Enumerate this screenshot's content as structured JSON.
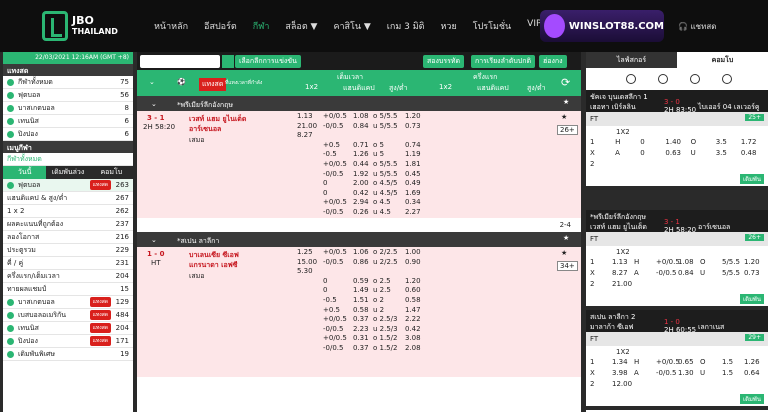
{
  "brand": {
    "line1": "JBO",
    "line2": "THAILAND",
    "partner": "WINSLOT88.COM",
    "chat": "แชทสด"
  },
  "nav": [
    "หน้าหลัก",
    "อีสปอร์ต",
    "กีฬา",
    "สล็อต ▼",
    "คาสิโน ▼",
    "เกม 3 มิติ",
    "หวย",
    "โปรโมชั่น",
    "VIP"
  ],
  "left": {
    "datetime": "22/03/2021 12:16AM (GMT +8)",
    "sec1": "แทงสด",
    "items1": [
      {
        "l": "กีฬาทั้งหมด",
        "c": "75"
      },
      {
        "l": "ฟุตบอล",
        "c": "56"
      },
      {
        "l": "บาสเกตบอล",
        "c": "8"
      },
      {
        "l": "เทนนิส",
        "c": "6"
      },
      {
        "l": "ปิงปอง",
        "c": "6"
      }
    ],
    "sec2": "เมนูกีฬา",
    "all": "กีฬาทั้งหมด",
    "tabs": [
      "วันนี้",
      "เดิมพันล่วงหน้า",
      "คอมโบ"
    ],
    "football": "ฟุตบอล",
    "live": "แทงสด",
    "fcount": "263",
    "items2": [
      {
        "l": "แฮนดิแคป & สูง/ต่ำ",
        "c": "267"
      },
      {
        "l": "1 x 2",
        "c": "262"
      },
      {
        "l": "ผลคะแนนที่ถูกต้อง",
        "c": "237"
      },
      {
        "l": "ลองโอกาส",
        "c": "216"
      },
      {
        "l": "ประตูรวม",
        "c": "229"
      },
      {
        "l": "คี่ / คู่",
        "c": "231"
      },
      {
        "l": "ครึ่งแรก/เต็มเวลา",
        "c": "204"
      },
      {
        "l": "ทายผลแชมป์",
        "c": "15"
      }
    ],
    "items3": [
      {
        "l": "บาสเกตบอล",
        "c": "129"
      },
      {
        "l": "เบสบอลอเมริกัน",
        "c": "484"
      },
      {
        "l": "เทนนิส",
        "c": "204"
      },
      {
        "l": "ปิงปอง",
        "c": "171"
      },
      {
        "l": "เดิมพันพิเศษ",
        "c": "19"
      }
    ]
  },
  "mid": {
    "search_btn": "เลือกลีกการแข่งขัน",
    "sort": "สองบรรทัด",
    "filter": "การเรียงลำดับปกติ",
    "odds": "ฮ่องกง",
    "h_full": "เต็มเวลา",
    "h_half": "ครึ่งแรก",
    "h_live": "แทงสด",
    "h_kick": "ที่แทงเวลาที่กำลัง",
    "h_1x2": "1x2",
    "h_hdp": "แฮนดิแคป",
    "h_ou": "สูง/ต่ำ",
    "league1": "*พรีเมียร์ลีกอังกฤษ",
    "score1": "3 - 1",
    "time1": "2H 58:20",
    "home1": "เวสท์ แฮม ยูไนเต็ด",
    "away1": "อาร์เซนอล",
    "draw": "เสมอ",
    "more1": "26+",
    "odds1": [
      [
        "1.13",
        "+0/0.5",
        "1.08",
        "o 5/5.5",
        "1.20"
      ],
      [
        "21.00",
        "-0/0.5",
        "0.84",
        "u 5/5.5",
        "0.73"
      ],
      [
        "8.27",
        "",
        "",
        "",
        ""
      ],
      [
        "",
        "+0.5",
        "0.71",
        "o 5",
        "0.74"
      ],
      [
        "",
        "-0.5",
        "1.26",
        "u 5",
        "1.19"
      ],
      [
        "",
        "+0/0.5",
        "0.44",
        "o 5/5.5",
        "1.81"
      ],
      [
        "",
        "-0/0.5",
        "1.92",
        "u 5/5.5",
        "0.45"
      ],
      [
        "",
        "0",
        "2.00",
        "o 4.5/5",
        "0.49"
      ],
      [
        "",
        "0",
        "0.42",
        "u 4.5/5",
        "1.69"
      ],
      [
        "",
        "+0/0.5",
        "2.94",
        "o 4.5",
        "0.34"
      ],
      [
        "",
        "-0/0.5",
        "0.26",
        "u 4.5",
        "2.27"
      ]
    ],
    "pager": "2-4",
    "league2": "*สเปน ลาลีกา",
    "score2": "1 - 0",
    "time2": "HT",
    "home2": "บาเลนเซีย ซีเอฟ",
    "away2": "แกรนาดา เอฟซี",
    "more2": "34+",
    "odds2": [
      [
        "1.25",
        "+0/0.5",
        "1.06",
        "o 2/2.5",
        "1.00"
      ],
      [
        "15.00",
        "-0/0.5",
        "0.86",
        "u 2/2.5",
        "0.90"
      ],
      [
        "5.30",
        "",
        "",
        "",
        ""
      ],
      [
        "",
        "0",
        "0.59",
        "o 2.5",
        "1.20"
      ],
      [
        "",
        "0",
        "1.49",
        "u 2.5",
        "0.60"
      ],
      [
        "",
        "-0.5",
        "1.51",
        "o 2",
        "0.58"
      ],
      [
        "",
        "+0.5",
        "0.58",
        "u 2",
        "1.47"
      ],
      [
        "",
        "+0/0.5",
        "0.37",
        "o 2.5/3",
        "2.22"
      ],
      [
        "",
        "-0/0.5",
        "2.23",
        "u 2.5/3",
        "0.42"
      ],
      [
        "",
        "+0/0.5",
        "0.31",
        "o 1.5/2",
        "3.08"
      ],
      [
        "",
        "-0/0.5",
        "0.37",
        "o 1.5/2",
        "2.08"
      ]
    ]
  },
  "right": {
    "tab1": "ไลฟ์สกอร์",
    "tab2": "คอมโบ",
    "c1": {
      "l": "ชัคเจ บุนเดสลีกา 1",
      "h": "เฮอทา เบิร์ลลิน",
      "a": "ไบเออร์ 04 เลเวอร์คูเซน",
      "s": "3 - 0",
      "t": "2H 83:50",
      "more": "25+",
      "rows": [
        [
          "1",
          "H",
          "0",
          "1.40",
          "O",
          "3.5",
          "1.72"
        ],
        [
          "X",
          "A",
          "0",
          "0.63",
          "U",
          "3.5",
          "0.48"
        ],
        [
          "2",
          "",
          "",
          "",
          "",
          "",
          ""
        ]
      ]
    },
    "c2": {
      "l": "*พรีเมียร์ลีกอังกฤษ",
      "h": "เวสท์ แฮม ยูไนเต็ด",
      "a": "อาร์เซนอล",
      "s": "3 - 1",
      "t": "2H 58:20",
      "more": "26+",
      "rows": [
        [
          "1",
          "1.13",
          "H",
          "+0/0.5",
          "1.08",
          "O",
          "5/5.5",
          "1.20"
        ],
        [
          "X",
          "8.27",
          "A",
          "-0/0.5",
          "0.84",
          "U",
          "5/5.5",
          "0.73"
        ],
        [
          "2",
          "21.00",
          "",
          "",
          "",
          "",
          "",
          ""
        ]
      ]
    },
    "c3": {
      "l": "สเปน ลาลีกา 2",
      "h": "มาลาก้า ซีเอฟ",
      "a": "เลกาเนส",
      "s": "1 - 0",
      "t": "2H 60:55",
      "more": "29+",
      "rows": [
        [
          "1",
          "1.34",
          "H",
          "+0/0.5",
          "0.65",
          "O",
          "1.5",
          "1.26"
        ],
        [
          "X",
          "3.98",
          "A",
          "-0/0.5",
          "1.30",
          "U",
          "1.5",
          "0.64"
        ],
        [
          "2",
          "12.00",
          "",
          "",
          "",
          "",
          "",
          ""
        ]
      ]
    },
    "c4": {
      "l": "*สเปน ลาลีกา"
    },
    "ft": "FT",
    "bet": "เดิมพัน",
    "hdr": "1X2"
  }
}
